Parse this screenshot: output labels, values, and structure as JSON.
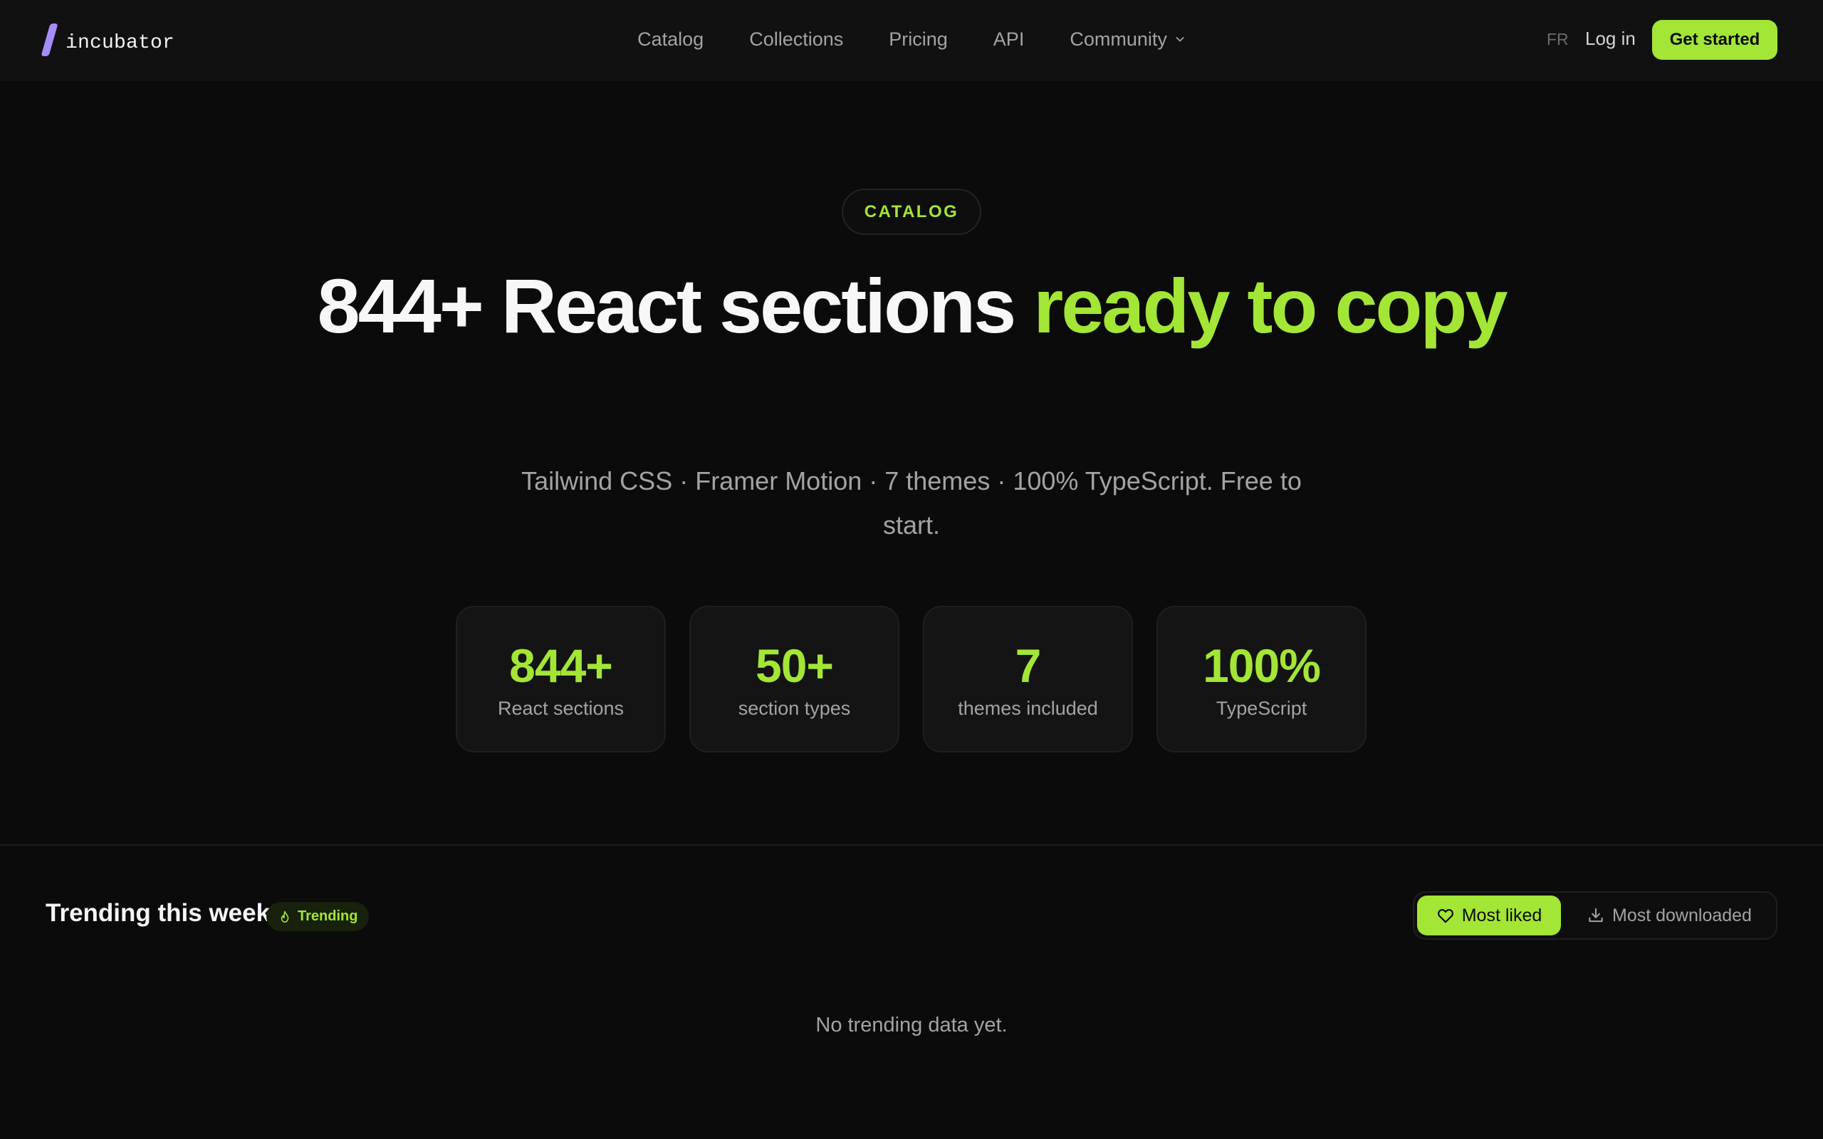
{
  "brand": {
    "name": "incubator",
    "accent": "#a3e635",
    "logo_color": "#a78bfa"
  },
  "nav": {
    "items": [
      {
        "label": "Catalog"
      },
      {
        "label": "Collections"
      },
      {
        "label": "Pricing"
      },
      {
        "label": "API"
      },
      {
        "label": "Community",
        "icon": "chevron-down-icon"
      }
    ],
    "lang": "FR",
    "login": "Log in",
    "cta": "Get started"
  },
  "hero": {
    "badge": "CATALOG",
    "title_main": "844+ React sections ",
    "title_accent": "ready to copy",
    "subtitle": "Tailwind CSS · Framer Motion · 7 themes · 100% TypeScript. Free to start."
  },
  "stats": [
    {
      "value": "844+",
      "label": "React sections"
    },
    {
      "value": "50+",
      "label": "section types"
    },
    {
      "value": "7",
      "label": "themes included"
    },
    {
      "value": "100%",
      "label": "TypeScript"
    }
  ],
  "trending": {
    "title": "Trending this week",
    "badge": "Trending",
    "badge_icon": "flame-icon",
    "tabs": [
      {
        "label": "Most liked",
        "icon": "heart-icon",
        "active": true
      },
      {
        "label": "Most downloaded",
        "icon": "download-icon",
        "active": false
      }
    ],
    "empty": "No trending data yet."
  }
}
